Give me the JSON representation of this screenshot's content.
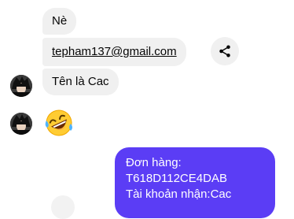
{
  "conversation": {
    "incoming": [
      {
        "text": "Nè"
      },
      {
        "text": "tepham137@gmail.com"
      },
      {
        "text": "Tên là Cac"
      }
    ],
    "emoji": "rolling-on-floor-laughing",
    "outgoing": {
      "lines": [
        "Đơn hàng:",
        "T618D112CE4DAB",
        "Tài khoản nhận:Cac"
      ],
      "color": "#5b3df5"
    }
  },
  "icons": {
    "share": "share-icon",
    "avatar": "avatar-icon"
  }
}
